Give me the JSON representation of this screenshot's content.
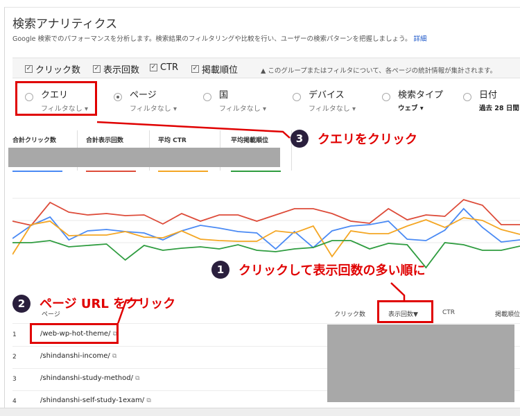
{
  "header": {
    "title": "検索アナリティクス",
    "description": "Google 検索でのパフォーマンスを分析します。検索結果のフィルタリングや比較を行い、ユーザーの検索パターンを把握しましょう。",
    "details_link": "詳細"
  },
  "metrics_toggles": [
    {
      "label": "クリック数",
      "checked": true
    },
    {
      "label": "表示回数",
      "checked": true
    },
    {
      "label": "CTR",
      "checked": true
    },
    {
      "label": "掲載順位",
      "checked": true
    }
  ],
  "notice": "このグループまたはフィルタについて、各ページの統計情報が集計されます。",
  "groups": [
    {
      "label": "クエリ",
      "sub": "フィルタなし",
      "selected": false
    },
    {
      "label": "ページ",
      "sub": "フィルタなし",
      "selected": true
    },
    {
      "label": "国",
      "sub": "フィルタなし",
      "selected": false
    },
    {
      "label": "デバイス",
      "sub": "フィルタなし",
      "selected": false
    },
    {
      "label": "検索タイプ",
      "sub": "ウェブ",
      "selected": false
    },
    {
      "label": "日付",
      "sub": "過去 28 日間",
      "selected": false
    }
  ],
  "summary": [
    {
      "label": "合計クリック数",
      "color": "#4a8af4"
    },
    {
      "label": "合計表示回数",
      "color": "#dd4b39"
    },
    {
      "label": "平均 CTR",
      "color": "#f4a623"
    },
    {
      "label": "平均掲載順位",
      "color": "#2e9c3f"
    }
  ],
  "chart_data": {
    "type": "line",
    "series": [
      {
        "values": [
          46,
          65,
          77,
          44,
          57,
          59,
          56,
          54,
          44,
          57,
          65,
          61,
          56,
          54,
          31,
          56,
          33,
          57,
          64,
          66,
          71,
          45,
          43,
          58,
          89,
          62,
          41,
          44
        ]
      },
      {
        "values": [
          71,
          65,
          98,
          84,
          80,
          82,
          79,
          80,
          67,
          82,
          71,
          80,
          80,
          71,
          80,
          89,
          89,
          82,
          71,
          68,
          89,
          73,
          80,
          78,
          102,
          94,
          66,
          66
        ]
      },
      {
        "values": [
          23,
          66,
          71,
          50,
          51,
          51,
          56,
          48,
          47,
          57,
          45,
          43,
          42,
          42,
          57,
          54,
          64,
          20,
          57,
          53,
          53,
          64,
          73,
          62,
          76,
          72,
          59,
          52
        ]
      },
      {
        "values": [
          40,
          40,
          43,
          34,
          36,
          38,
          15,
          36,
          29,
          32,
          34,
          31,
          37,
          29,
          27,
          31,
          33,
          43,
          43,
          31,
          39,
          37,
          4,
          40,
          37,
          29,
          29,
          35
        ]
      }
    ]
  },
  "annotations": [
    {
      "num": "1",
      "text": "クリックして表示回数の多い順に"
    },
    {
      "num": "2",
      "text": "ページ URL をクリック"
    },
    {
      "num": "3",
      "text": "クエリをクリック"
    }
  ],
  "table": {
    "headers": {
      "page": "ページ",
      "clicks": "クリック数",
      "impressions": "表示回数▼",
      "ctr": "CTR",
      "position": "掲載順位"
    },
    "rows": [
      {
        "num": "1",
        "url": "/web-wp-hot-theme/"
      },
      {
        "num": "2",
        "url": "/shindanshi-income/"
      },
      {
        "num": "3",
        "url": "/shindanshi-study-method/"
      },
      {
        "num": "4",
        "url": "/shindanshi-self-study-1exam/"
      }
    ]
  }
}
